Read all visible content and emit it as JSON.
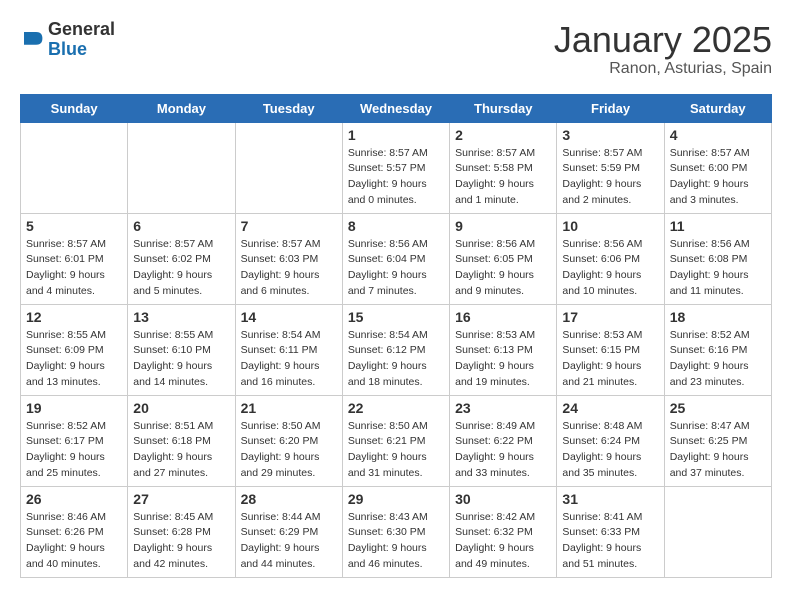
{
  "header": {
    "logo_general": "General",
    "logo_blue": "Blue",
    "title": "January 2025",
    "subtitle": "Ranon, Asturias, Spain"
  },
  "days_of_week": [
    "Sunday",
    "Monday",
    "Tuesday",
    "Wednesday",
    "Thursday",
    "Friday",
    "Saturday"
  ],
  "weeks": [
    [
      {
        "day": "",
        "sunrise": "",
        "sunset": "",
        "daylight": "",
        "empty": true
      },
      {
        "day": "",
        "sunrise": "",
        "sunset": "",
        "daylight": "",
        "empty": true
      },
      {
        "day": "",
        "sunrise": "",
        "sunset": "",
        "daylight": "",
        "empty": true
      },
      {
        "day": "1",
        "sunrise": "Sunrise: 8:57 AM",
        "sunset": "Sunset: 5:57 PM",
        "daylight": "Daylight: 9 hours and 0 minutes.",
        "empty": false
      },
      {
        "day": "2",
        "sunrise": "Sunrise: 8:57 AM",
        "sunset": "Sunset: 5:58 PM",
        "daylight": "Daylight: 9 hours and 1 minute.",
        "empty": false
      },
      {
        "day": "3",
        "sunrise": "Sunrise: 8:57 AM",
        "sunset": "Sunset: 5:59 PM",
        "daylight": "Daylight: 9 hours and 2 minutes.",
        "empty": false
      },
      {
        "day": "4",
        "sunrise": "Sunrise: 8:57 AM",
        "sunset": "Sunset: 6:00 PM",
        "daylight": "Daylight: 9 hours and 3 minutes.",
        "empty": false
      }
    ],
    [
      {
        "day": "5",
        "sunrise": "Sunrise: 8:57 AM",
        "sunset": "Sunset: 6:01 PM",
        "daylight": "Daylight: 9 hours and 4 minutes.",
        "empty": false
      },
      {
        "day": "6",
        "sunrise": "Sunrise: 8:57 AM",
        "sunset": "Sunset: 6:02 PM",
        "daylight": "Daylight: 9 hours and 5 minutes.",
        "empty": false
      },
      {
        "day": "7",
        "sunrise": "Sunrise: 8:57 AM",
        "sunset": "Sunset: 6:03 PM",
        "daylight": "Daylight: 9 hours and 6 minutes.",
        "empty": false
      },
      {
        "day": "8",
        "sunrise": "Sunrise: 8:56 AM",
        "sunset": "Sunset: 6:04 PM",
        "daylight": "Daylight: 9 hours and 7 minutes.",
        "empty": false
      },
      {
        "day": "9",
        "sunrise": "Sunrise: 8:56 AM",
        "sunset": "Sunset: 6:05 PM",
        "daylight": "Daylight: 9 hours and 9 minutes.",
        "empty": false
      },
      {
        "day": "10",
        "sunrise": "Sunrise: 8:56 AM",
        "sunset": "Sunset: 6:06 PM",
        "daylight": "Daylight: 9 hours and 10 minutes.",
        "empty": false
      },
      {
        "day": "11",
        "sunrise": "Sunrise: 8:56 AM",
        "sunset": "Sunset: 6:08 PM",
        "daylight": "Daylight: 9 hours and 11 minutes.",
        "empty": false
      }
    ],
    [
      {
        "day": "12",
        "sunrise": "Sunrise: 8:55 AM",
        "sunset": "Sunset: 6:09 PM",
        "daylight": "Daylight: 9 hours and 13 minutes.",
        "empty": false
      },
      {
        "day": "13",
        "sunrise": "Sunrise: 8:55 AM",
        "sunset": "Sunset: 6:10 PM",
        "daylight": "Daylight: 9 hours and 14 minutes.",
        "empty": false
      },
      {
        "day": "14",
        "sunrise": "Sunrise: 8:54 AM",
        "sunset": "Sunset: 6:11 PM",
        "daylight": "Daylight: 9 hours and 16 minutes.",
        "empty": false
      },
      {
        "day": "15",
        "sunrise": "Sunrise: 8:54 AM",
        "sunset": "Sunset: 6:12 PM",
        "daylight": "Daylight: 9 hours and 18 minutes.",
        "empty": false
      },
      {
        "day": "16",
        "sunrise": "Sunrise: 8:53 AM",
        "sunset": "Sunset: 6:13 PM",
        "daylight": "Daylight: 9 hours and 19 minutes.",
        "empty": false
      },
      {
        "day": "17",
        "sunrise": "Sunrise: 8:53 AM",
        "sunset": "Sunset: 6:15 PM",
        "daylight": "Daylight: 9 hours and 21 minutes.",
        "empty": false
      },
      {
        "day": "18",
        "sunrise": "Sunrise: 8:52 AM",
        "sunset": "Sunset: 6:16 PM",
        "daylight": "Daylight: 9 hours and 23 minutes.",
        "empty": false
      }
    ],
    [
      {
        "day": "19",
        "sunrise": "Sunrise: 8:52 AM",
        "sunset": "Sunset: 6:17 PM",
        "daylight": "Daylight: 9 hours and 25 minutes.",
        "empty": false
      },
      {
        "day": "20",
        "sunrise": "Sunrise: 8:51 AM",
        "sunset": "Sunset: 6:18 PM",
        "daylight": "Daylight: 9 hours and 27 minutes.",
        "empty": false
      },
      {
        "day": "21",
        "sunrise": "Sunrise: 8:50 AM",
        "sunset": "Sunset: 6:20 PM",
        "daylight": "Daylight: 9 hours and 29 minutes.",
        "empty": false
      },
      {
        "day": "22",
        "sunrise": "Sunrise: 8:50 AM",
        "sunset": "Sunset: 6:21 PM",
        "daylight": "Daylight: 9 hours and 31 minutes.",
        "empty": false
      },
      {
        "day": "23",
        "sunrise": "Sunrise: 8:49 AM",
        "sunset": "Sunset: 6:22 PM",
        "daylight": "Daylight: 9 hours and 33 minutes.",
        "empty": false
      },
      {
        "day": "24",
        "sunrise": "Sunrise: 8:48 AM",
        "sunset": "Sunset: 6:24 PM",
        "daylight": "Daylight: 9 hours and 35 minutes.",
        "empty": false
      },
      {
        "day": "25",
        "sunrise": "Sunrise: 8:47 AM",
        "sunset": "Sunset: 6:25 PM",
        "daylight": "Daylight: 9 hours and 37 minutes.",
        "empty": false
      }
    ],
    [
      {
        "day": "26",
        "sunrise": "Sunrise: 8:46 AM",
        "sunset": "Sunset: 6:26 PM",
        "daylight": "Daylight: 9 hours and 40 minutes.",
        "empty": false
      },
      {
        "day": "27",
        "sunrise": "Sunrise: 8:45 AM",
        "sunset": "Sunset: 6:28 PM",
        "daylight": "Daylight: 9 hours and 42 minutes.",
        "empty": false
      },
      {
        "day": "28",
        "sunrise": "Sunrise: 8:44 AM",
        "sunset": "Sunset: 6:29 PM",
        "daylight": "Daylight: 9 hours and 44 minutes.",
        "empty": false
      },
      {
        "day": "29",
        "sunrise": "Sunrise: 8:43 AM",
        "sunset": "Sunset: 6:30 PM",
        "daylight": "Daylight: 9 hours and 46 minutes.",
        "empty": false
      },
      {
        "day": "30",
        "sunrise": "Sunrise: 8:42 AM",
        "sunset": "Sunset: 6:32 PM",
        "daylight": "Daylight: 9 hours and 49 minutes.",
        "empty": false
      },
      {
        "day": "31",
        "sunrise": "Sunrise: 8:41 AM",
        "sunset": "Sunset: 6:33 PM",
        "daylight": "Daylight: 9 hours and 51 minutes.",
        "empty": false
      },
      {
        "day": "",
        "sunrise": "",
        "sunset": "",
        "daylight": "",
        "empty": true
      }
    ]
  ]
}
